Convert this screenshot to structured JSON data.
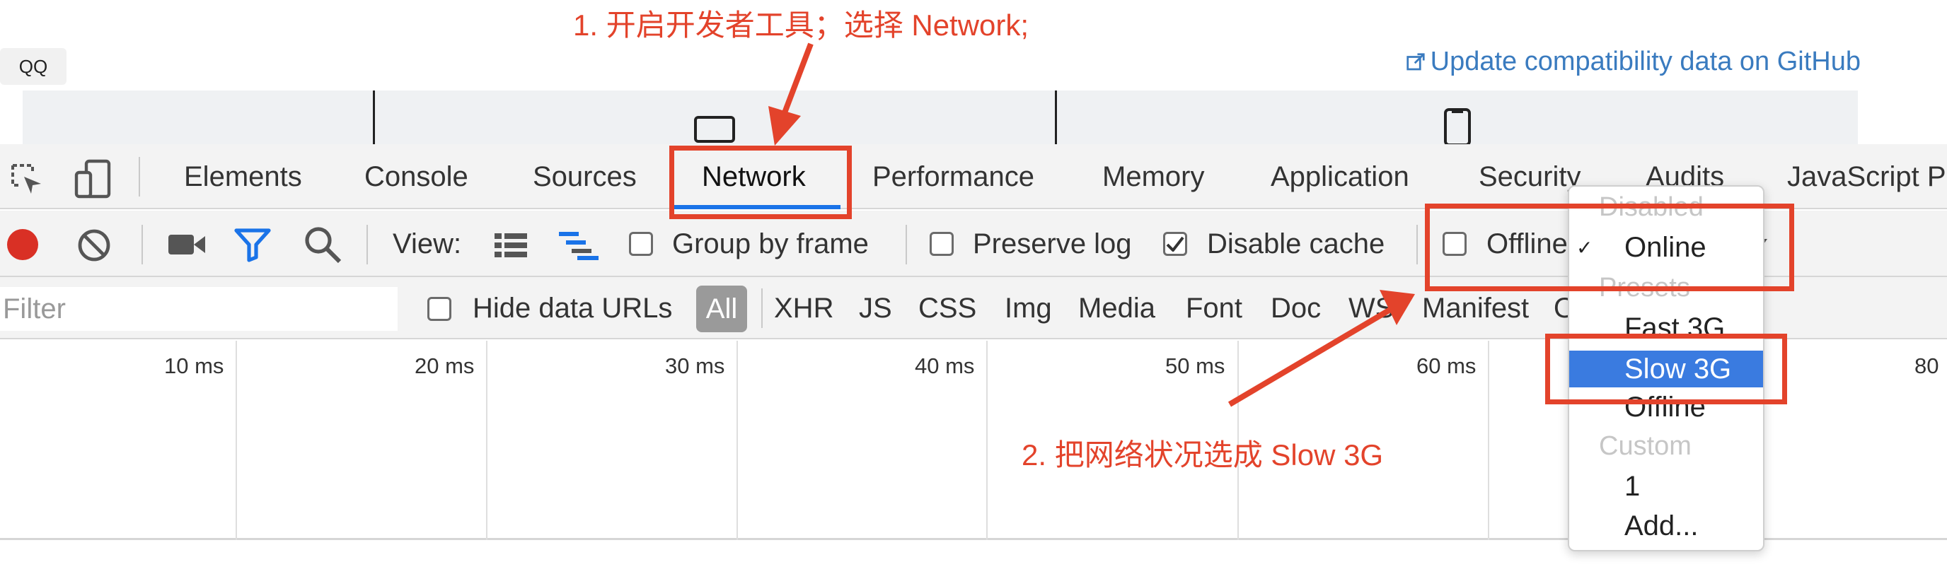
{
  "page": {
    "tab_label": "QQ",
    "update_link": "Update compatibility data on GitHub"
  },
  "devtools": {
    "tabs": [
      "Elements",
      "Console",
      "Sources",
      "Network",
      "Performance",
      "Memory",
      "Application",
      "Security",
      "Audits",
      "JavaScript P"
    ],
    "active_tab": "Network",
    "toolbar": {
      "view_label": "View:",
      "group_by_frame": "Group by frame",
      "preserve_log": "Preserve log",
      "disable_cache": "Disable cache",
      "disable_cache_checked": true,
      "offline": "Offline"
    },
    "filter": {
      "placeholder": "Filter",
      "hide_data_urls": "Hide data URLs",
      "types": [
        "All",
        "XHR",
        "JS",
        "CSS",
        "Img",
        "Media",
        "Font",
        "Doc",
        "WS",
        "Manifest",
        "O"
      ]
    },
    "timeline_ticks": [
      "10 ms",
      "20 ms",
      "30 ms",
      "40 ms",
      "50 ms",
      "60 ms",
      "80"
    ],
    "throttle_menu": {
      "disabled_header": "Disabled",
      "online": "Online",
      "online_checkmark": "✓",
      "presets_header": "Presets",
      "fast3g": "Fast 3G",
      "slow3g": "Slow 3G",
      "offline": "Offline",
      "custom_header": "Custom",
      "custom_1": "1",
      "add": "Add..."
    }
  },
  "annotations": {
    "step1": "1. 开启开发者工具；选择 Network;",
    "step2": "2. 把网络状况选成 Slow 3G",
    "color": "#e3432b"
  },
  "colors": {
    "accent": "#1a73e8",
    "record": "#d93025",
    "link": "#3a7bbf",
    "selection": "#3a7be0"
  }
}
